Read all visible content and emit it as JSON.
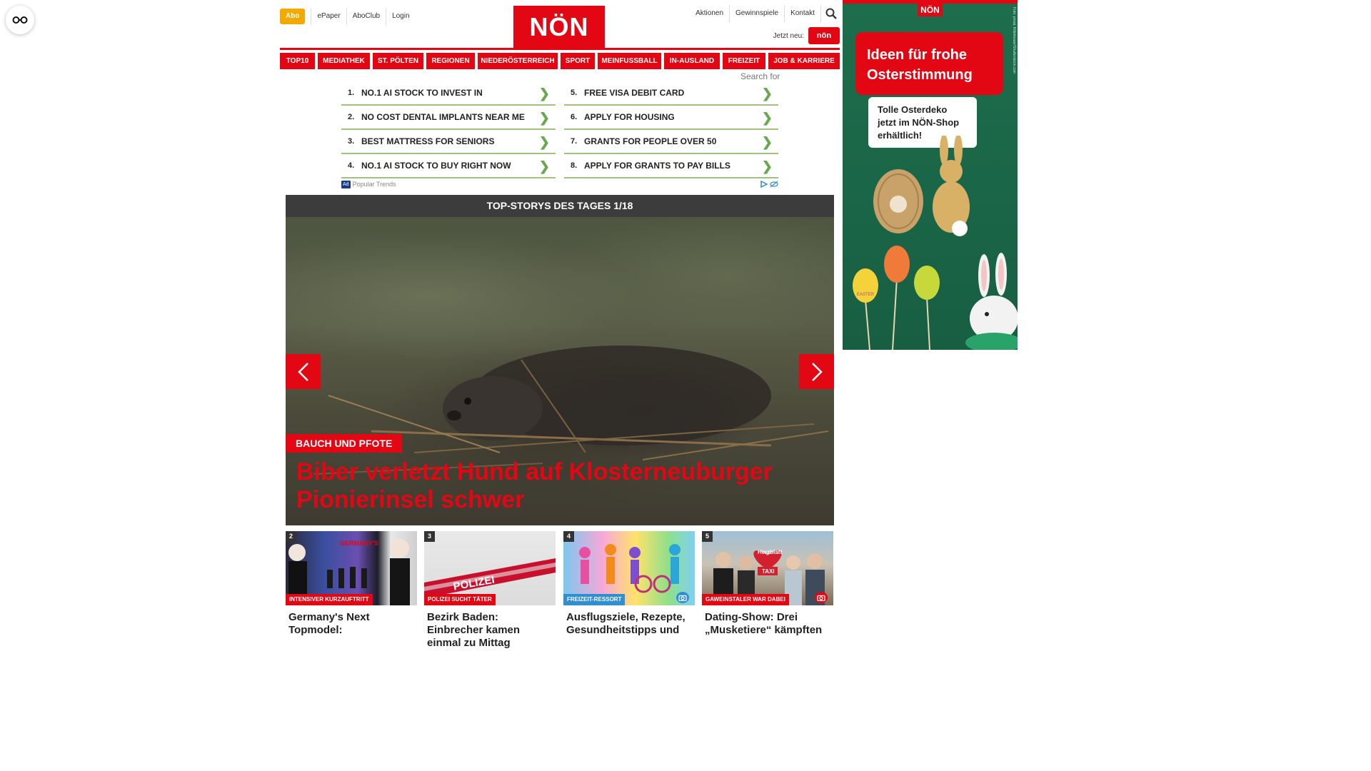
{
  "header": {
    "abo_label": "Abo",
    "links_left": [
      "ePaper",
      "AboClub",
      "Login"
    ],
    "logo_text": "NÖN",
    "links_right": [
      "Aktionen",
      "Gewinnspiele",
      "Kontakt"
    ],
    "jetzt_label": "Jetzt neu:",
    "jetzt_badge": "nön"
  },
  "nav": {
    "items": [
      "TOP10",
      "MEDIATHEK",
      "ST. PÖLTEN",
      "REGIONEN",
      "NIEDERÖSTERREICH",
      "SPORT",
      "MEINFUSSBALL",
      "IN-AUSLAND",
      "FREIZEIT",
      "JOB & KARRIERE"
    ]
  },
  "ads": {
    "search_for": "Search for",
    "left": [
      {
        "num": "1.",
        "text": "NO.1 AI STOCK TO INVEST IN"
      },
      {
        "num": "2.",
        "text": "NO COST DENTAL IMPLANTS NEAR ME"
      },
      {
        "num": "3.",
        "text": "BEST MATTRESS FOR SENIORS"
      },
      {
        "num": "4.",
        "text": "NO.1 AI STOCK TO BUY RIGHT NOW"
      }
    ],
    "right": [
      {
        "num": "5.",
        "text": "FREE VISA DEBIT CARD"
      },
      {
        "num": "6.",
        "text": "APPLY FOR HOUSING"
      },
      {
        "num": "7.",
        "text": "GRANTS FOR PEOPLE OVER 50"
      },
      {
        "num": "8.",
        "text": "APPLY FOR GRANTS TO PAY BILLS"
      }
    ],
    "ad_tag": "Ad",
    "footer_text": "Popular Trends"
  },
  "top_stories": {
    "bar_title": "TOP-STORYS DES TAGES 1/18",
    "hero_kicker": "BAUCH UND PFOTE",
    "hero_title": "Biber verletzt Hund auf Klosterneuburger Pionierinsel schwer"
  },
  "cards": [
    {
      "num": "2",
      "tag": "INTENSIVER KURZAUFTRITT",
      "title": "Germany's Next Topmodel:"
    },
    {
      "num": "3",
      "tag": "POLIZEI SUCHT TÄTER",
      "title": "Bezirk Baden: Einbrecher kamen einmal zu Mittag"
    },
    {
      "num": "4",
      "tag": "FREIZEIT-RESSORT",
      "title": "Ausflugsziele, Rezepte, Gesundheitstipps und"
    },
    {
      "num": "5",
      "tag": "GAWEINSTALER WAR DABEI",
      "title": "Dating-Show: Drei „Musketiere“ kämpften"
    }
  ],
  "card_images": {
    "gntm_sign": "GERMANY'S",
    "police_tape": "POLIZEI",
    "heart_sign": "Herzblatt",
    "taxi_sign": "TAXI"
  },
  "side_ad": {
    "logo": "NÖN",
    "headline": "Ideen für frohe Osterstimmung",
    "note": "Tolle Osterdeko jetzt im NÖN-Shop erhältlich!",
    "egg_label": "EASTER",
    "credit": "Foto: privat, Kittelmoser/Shutterstock.com"
  },
  "colors": {
    "brand_red": "#e30613",
    "abo_yellow": "#f2a900",
    "ad_green": "#1d6e4d",
    "stories_bar": "#3c3c3c",
    "tag_blue": "#2f8fd0"
  }
}
